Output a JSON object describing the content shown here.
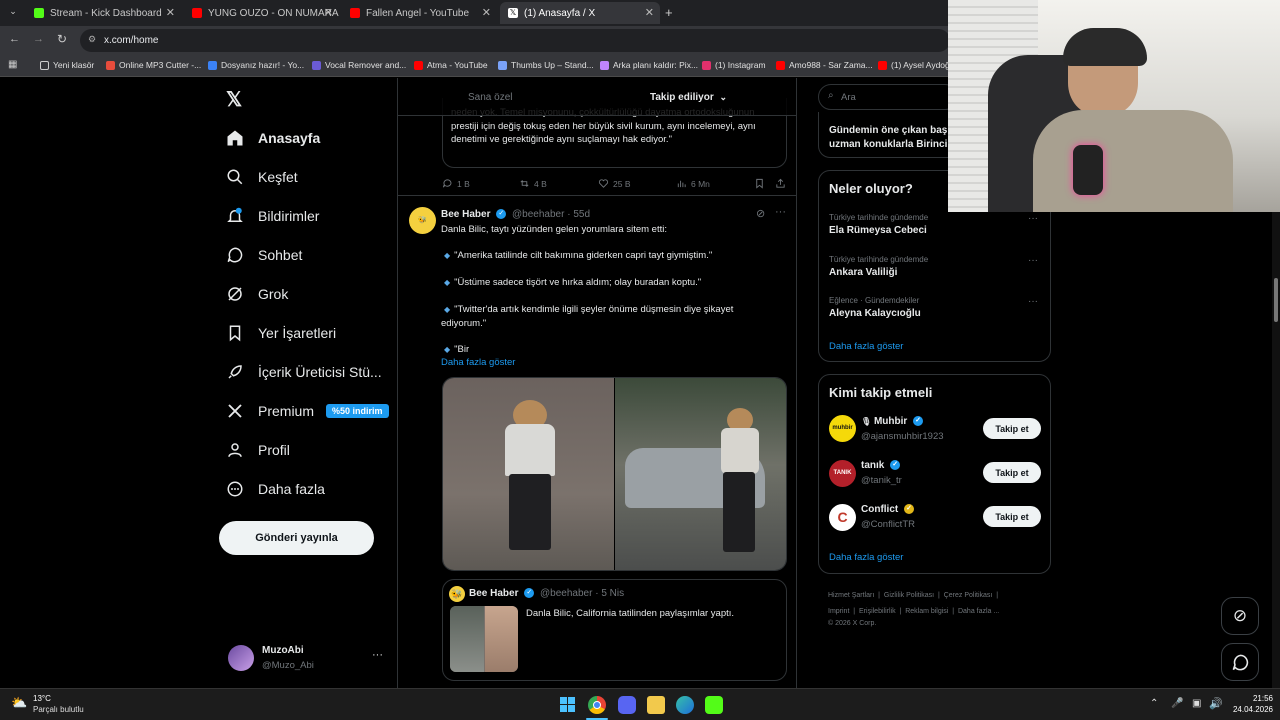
{
  "browser": {
    "tabs": [
      {
        "label": "Stream - Kick Dashboard",
        "color": "#53fc18"
      },
      {
        "label": "YUNG OUZO - ON NUMARA -",
        "color": "#ff0000"
      },
      {
        "label": "Fallen Angel - YouTube",
        "color": "#ff0000"
      },
      {
        "label": "(1) Anasayfa / X",
        "color": "#ffffff"
      }
    ],
    "url": "x.com/home",
    "bookmarks": [
      "Yeni klasör",
      "Online MP3 Cutter -...",
      "Dosyanız hazır! - Yo...",
      "Vocal Remover and...",
      "Atma - YouTube",
      "Thumbs Up – Stand...",
      "Arka planı kaldır: Pix...",
      "(1) Instagram",
      "Amo988 - Sar Zama...",
      "(1) Aysel Aydoğ"
    ]
  },
  "nav": {
    "items": [
      {
        "label": "Anasayfa",
        "icon": "home-icon"
      },
      {
        "label": "Keşfet",
        "icon": "search-icon"
      },
      {
        "label": "Bildirimler",
        "icon": "bell-icon",
        "badge": "1"
      },
      {
        "label": "Sohbet",
        "icon": "chat-icon"
      },
      {
        "label": "Grok",
        "icon": "grok-icon"
      },
      {
        "label": "Yer İşaretleri",
        "icon": "bookmark-icon"
      },
      {
        "label": "İçerik Üreticisi Stü...",
        "icon": "rocket-icon"
      },
      {
        "label": "Premium",
        "icon": "x-logo-icon",
        "badge": "%50 indirim"
      },
      {
        "label": "Profil",
        "icon": "person-icon"
      },
      {
        "label": "Daha fazla",
        "icon": "more-circle-icon"
      }
    ],
    "post_button": "Gönderi yayınla",
    "user": {
      "name": "MuzoAbi",
      "handle": "@Muzo_Abi"
    }
  },
  "feed": {
    "tabs": [
      "Sana özel",
      "Takip ediliyor"
    ],
    "prev_tweet": {
      "text_lines": [
        "neden yok. Temel misyonunu, çokkültürlülüğü dayatma ortodoksluğunun",
        "prestiji için değiş tokuş eden her büyük sivil kurum, aynı incelemeyi, aynı",
        "denetimi ve gerektiğinde aynı suçlamayı hak ediyor.\""
      ],
      "replies": "1 B",
      "reposts": "4 B",
      "likes": "25 B",
      "views": "6 Mn"
    },
    "tweet": {
      "name": "Bee Haber",
      "handle": "@beehaber",
      "time": "55d",
      "intro": "Danla Bilic, taytı yüzünden gelen yorumlara sitem etti:",
      "bullets": [
        "\"Amerika tatilinde cilt bakımına giderken capri tayt giymiştim.\"",
        "\"Üstüme sadece tişört ve hırka aldım; olay buradan koptu.\"",
        "\"Twitter'da artık kendimle ilgili şeyler önüme düşmesin diye şikayet ediyorum.\"",
        "\"Bir"
      ],
      "show_more": "Daha fazla göster",
      "quote": {
        "name": "Bee Haber",
        "handle": "@beehaber",
        "time": "5 Nis",
        "text": "Danla Bilic, California tatilinden paylaşımlar yaptı."
      }
    }
  },
  "right": {
    "search_placeholder": "Ara",
    "live_text": [
      "Gündemin öne çıkan başlı",
      "uzman konuklarla Birinci"
    ],
    "trends_title": "Neler oluyor?",
    "trends": [
      {
        "category": "Türkiye tarihinde gündemde",
        "name": "Ela Rümeysa Cebeci"
      },
      {
        "category": "Türkiye tarihinde gündemde",
        "name": "Ankara Valiliği"
      },
      {
        "category": "Eğlence · Gündemdekiler",
        "name": "Aleyna Kalaycıoğlu"
      }
    ],
    "trends_more": "Daha fazla göster",
    "follow_title": "Kimi takip etmeli",
    "follow": [
      {
        "name": "Muhbir",
        "handle": "@ajansmuhbir1923",
        "button": "Takip et",
        "avatar_color": "#f5d90a",
        "avatar_text": "muhbir"
      },
      {
        "name": "tanık",
        "handle": "@tanik_tr",
        "button": "Takip et",
        "avatar_color": "#b3202a",
        "avatar_text": "TANIK"
      },
      {
        "name": "Conflict",
        "handle": "@ConflictTR",
        "button": "Takip et",
        "avatar_color": "#ffffff",
        "avatar_text": "C"
      }
    ],
    "follow_more": "Daha fazla göster",
    "footer": [
      "Hizmet Şartları",
      "Gizlilik Politikası",
      "Çerez Politikası",
      "Imprint",
      "Erişilebilirlik",
      "Reklam bilgisi",
      "Daha fazla ...",
      "© 2026 X Corp."
    ]
  },
  "taskbar": {
    "weather_temp": "13°C",
    "weather_desc": "Parçalı bulutlu",
    "time": "21:56",
    "date": "24.04.2026"
  }
}
